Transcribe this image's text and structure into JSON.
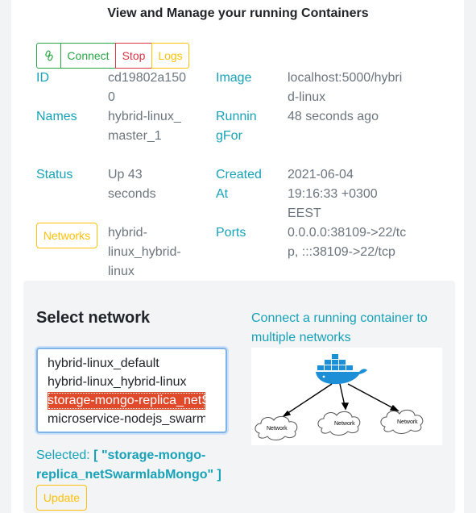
{
  "page": {
    "title": "View and Manage your running Containers"
  },
  "actions": {
    "link_icon": "link-icon",
    "connect": "Connect",
    "stop": "Stop",
    "logs": "Logs"
  },
  "container": {
    "id_label": "ID",
    "id_value": "cd19802a1500",
    "image_label": "Image",
    "image_value": "localhost:5000/hybrid-linux",
    "names_label": "Names",
    "names_value": "hybrid-linux_master_1",
    "runningfor_label": "RunningFor",
    "runningfor_value": "48 seconds ago",
    "status_label": "Status",
    "status_value": "Up 43 seconds",
    "created_label": "Created At",
    "created_value": "2021-06-04 19:16:33 +0300 EEST",
    "networks_button": "Networks",
    "networks_value": "hybrid-linux_hybrid-linux",
    "ports_label": "Ports",
    "ports_value": "0.0.0.0:38109->22/tcp, :::38109->22/tcp"
  },
  "network_panel": {
    "heading": "Select network",
    "options": [
      "hybrid-linux_default",
      "hybrid-linux_hybrid-linux",
      "storage-mongo-replica_netSwarmlabMongo",
      "microservice-nodejs_swarmlab"
    ],
    "selected_index": 2,
    "selected_prefix": "Selected:",
    "selected_value": "[ \"storage-mongo-replica_netSwarmlabMongo\" ]",
    "update_button": "Update",
    "help_link": "Connect a running container to multiple networks",
    "diagram": {
      "network_labels": [
        "Network",
        "Network",
        "Network"
      ],
      "whale_icon": "docker-whale-icon",
      "colors": {
        "whale": "#1d8fd6",
        "boxes": "#1d8fd6"
      }
    }
  },
  "colors": {
    "info": "#17a2b8",
    "success": "#28a745",
    "danger": "#dc3545",
    "warning": "#ffc107",
    "selected_option": "#e1492b"
  }
}
